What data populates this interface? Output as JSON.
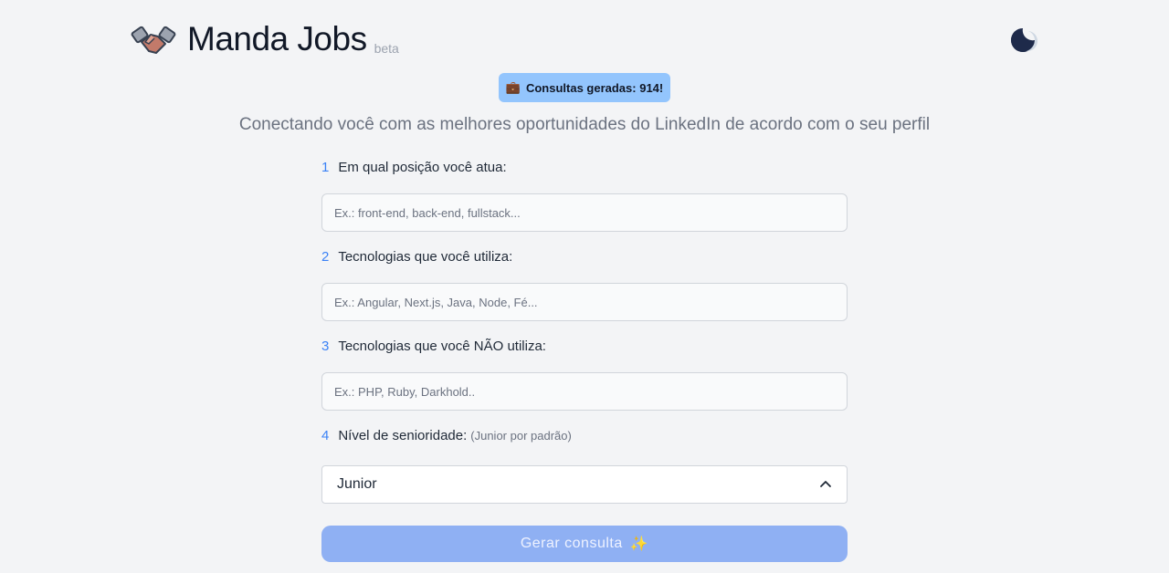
{
  "header": {
    "title": "Manda Jobs",
    "beta": "beta",
    "logo_icon": "handshake-icon",
    "theme_icon": "moon-icon"
  },
  "badge": {
    "icon": "briefcase-icon",
    "emoji": "💼",
    "text": "Consultas geradas: 914!"
  },
  "tagline": "Conectando você com as melhores oportunidades do LinkedIn de acordo com o seu perfil",
  "form": {
    "questions": [
      {
        "num": "1",
        "label": "Em qual posição você atua:",
        "placeholder": "Ex.: front-end, back-end, fullstack...",
        "value": ""
      },
      {
        "num": "2",
        "label": "Tecnologias que você utiliza:",
        "placeholder": "Ex.: Angular, Next.js, Java, Node, Fé...",
        "value": ""
      },
      {
        "num": "3",
        "label": "Tecnologias que você NÃO utiliza:",
        "placeholder": "Ex.: PHP, Ruby, Darkhold..",
        "value": ""
      },
      {
        "num": "4",
        "label": "Nível de senioridade:",
        "hint": "(Junior por padrão)"
      }
    ],
    "seniority_selected": "Junior",
    "submit_label": "Gerar consulta",
    "submit_emoji": "✨"
  },
  "colors": {
    "background": "#f3f4f6",
    "accent": "#3b82f6",
    "badge": "#93c5fd",
    "submit": "#8fb0f3"
  }
}
